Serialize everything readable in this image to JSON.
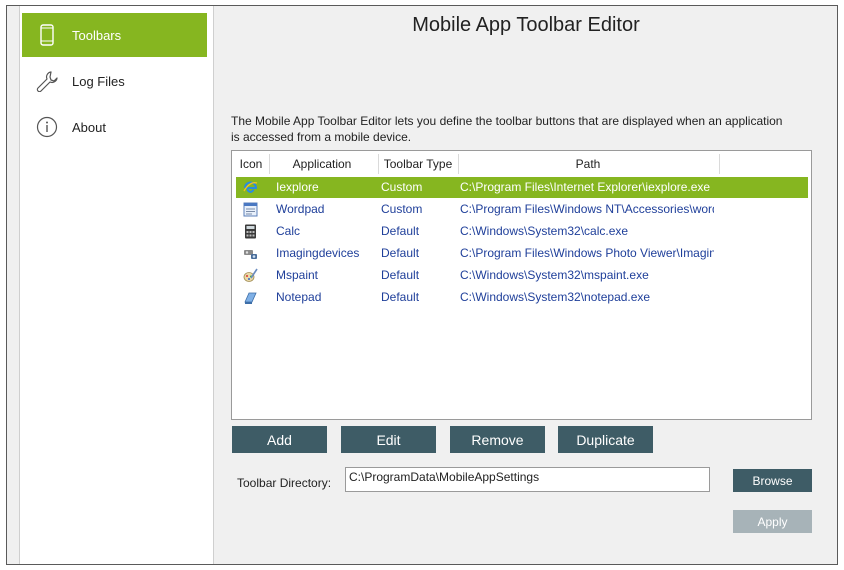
{
  "sidebar": {
    "items": [
      {
        "label": "Toolbars",
        "icon": "phone-icon",
        "active": true
      },
      {
        "label": "Log Files",
        "icon": "wrench-icon",
        "active": false
      },
      {
        "label": "About",
        "icon": "info-icon",
        "active": false
      }
    ]
  },
  "main": {
    "title": "Mobile App Toolbar Editor",
    "description": "The Mobile App Toolbar Editor lets you define the toolbar buttons that are displayed when an application is accessed from a mobile device.",
    "list": {
      "columns": [
        "Icon",
        "Application",
        "Toolbar Type",
        "Path"
      ],
      "rows": [
        {
          "icon": "ie-icon",
          "application": "Iexplore",
          "type": "Custom",
          "path": "C:\\Program Files\\Internet Explorer\\iexplore.exe",
          "selected": true
        },
        {
          "icon": "wordpad-icon",
          "application": "Wordpad",
          "type": "Custom",
          "path": "C:\\Program Files\\Windows NT\\Accessories\\wordpad.exe",
          "selected": false
        },
        {
          "icon": "calc-icon",
          "application": "Calc",
          "type": "Default",
          "path": "C:\\Windows\\System32\\calc.exe",
          "selected": false
        },
        {
          "icon": "imaging-icon",
          "application": "Imagingdevices",
          "type": "Default",
          "path": "C:\\Program Files\\Windows Photo Viewer\\ImagingDevices.exe",
          "selected": false
        },
        {
          "icon": "mspaint-icon",
          "application": "Mspaint",
          "type": "Default",
          "path": "C:\\Windows\\System32\\mspaint.exe",
          "selected": false
        },
        {
          "icon": "notepad-icon",
          "application": "Notepad",
          "type": "Default",
          "path": "C:\\Windows\\System32\\notepad.exe",
          "selected": false
        }
      ]
    },
    "buttons": {
      "add": "Add",
      "edit": "Edit",
      "remove": "Remove",
      "duplicate": "Duplicate"
    },
    "toolbar_directory": {
      "label": "Toolbar Directory:",
      "value": "C:\\ProgramData\\MobileAppSettings"
    },
    "browse_label": "Browse",
    "apply_label": "Apply"
  },
  "colors": {
    "accent": "#86b620",
    "button": "#3e5c66",
    "button_disabled": "#a7b3b8",
    "link_text": "#1f3f9a"
  }
}
